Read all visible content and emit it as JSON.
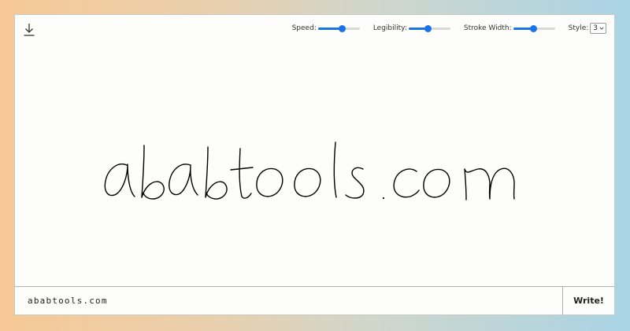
{
  "toolbar": {
    "download_icon": "download-icon",
    "speed": {
      "label": "Speed:",
      "value": 0.56
    },
    "legibility": {
      "label": "Legibility:",
      "value": 0.45
    },
    "stroke_width": {
      "label": "Stroke Width:",
      "value": 0.47
    },
    "style": {
      "label": "Style:",
      "value": "3"
    }
  },
  "canvas": {
    "handwritten_text": "ababtools.com",
    "ink_color": "#000000"
  },
  "input": {
    "value": "ababtools.com"
  },
  "write_button": {
    "label": "Write!"
  },
  "colors": {
    "accent": "#1a73e8",
    "panel": "#fdfdfb"
  }
}
